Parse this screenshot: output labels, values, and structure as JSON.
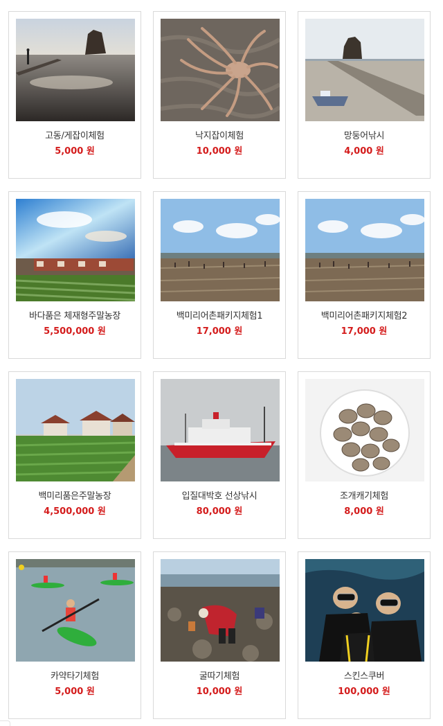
{
  "products": [
    {
      "name": "고동/게잡이체험",
      "price": "5,000 원",
      "image": "rocky-tidal-flat-sunset"
    },
    {
      "name": "낙지잡이체험",
      "price": "10,000 원",
      "image": "octopus-on-mud"
    },
    {
      "name": "망둥어낚시",
      "price": "4,000 원",
      "image": "causeway-boat"
    },
    {
      "name": "바다품은 체재형주말농장",
      "price": "5,500,000 원",
      "image": "farm-cabins-sky"
    },
    {
      "name": "백미리어촌패키지체험1",
      "price": "17,000 원",
      "image": "mudflat-crowd"
    },
    {
      "name": "백미리어촌패키지체험2",
      "price": "17,000 원",
      "image": "mudflat-crowd"
    },
    {
      "name": "백미리품은주말농장",
      "price": "4,500,000 원",
      "image": "vegetable-field-houses"
    },
    {
      "name": "입질대박호 선상낚시",
      "price": "80,000 원",
      "image": "red-fishing-boat"
    },
    {
      "name": "조개캐기체험",
      "price": "8,000 원",
      "image": "clams-in-bowl"
    },
    {
      "name": "카약타기체험",
      "price": "5,000 원",
      "image": "kayaks-on-water"
    },
    {
      "name": "굴따기체험",
      "price": "10,000 원",
      "image": "oyster-picking-rocks"
    },
    {
      "name": "스킨스쿠버",
      "price": "100,000 원",
      "image": "scuba-divers"
    }
  ],
  "colors": {
    "price": "#d41c1c",
    "name": "#333333",
    "border": "#d9d9d9"
  }
}
